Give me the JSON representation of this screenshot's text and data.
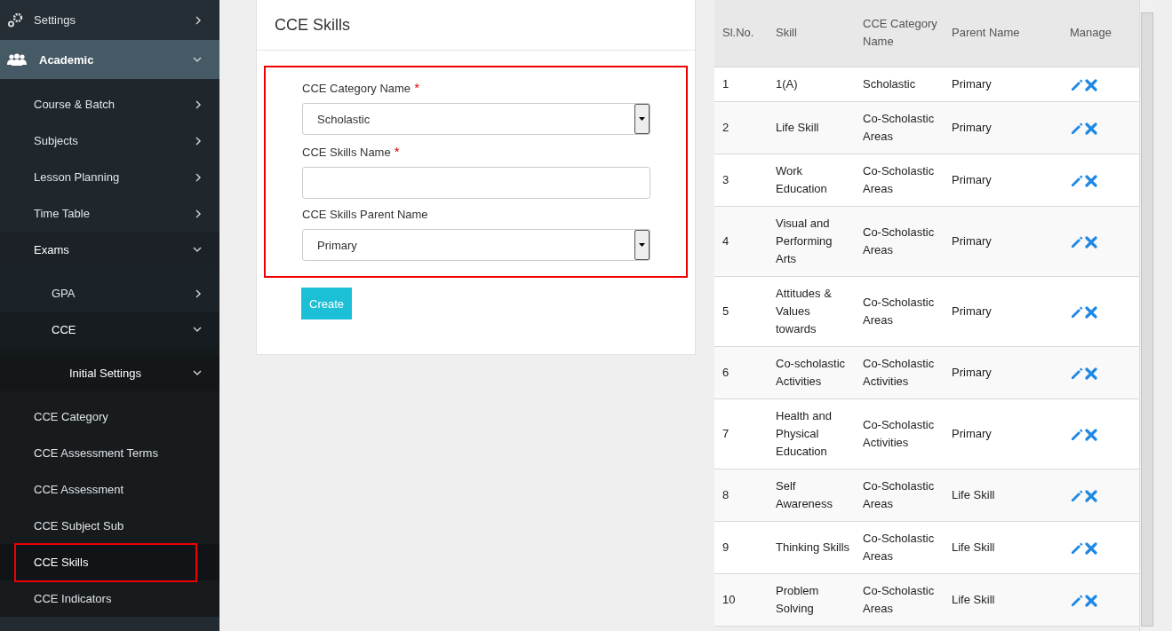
{
  "sidebar": {
    "items": [
      {
        "label": "Settings",
        "expanded": false
      },
      {
        "label": "Academic",
        "expanded": true,
        "children": [
          {
            "label": "Course & Batch",
            "expanded": false
          },
          {
            "label": "Subjects",
            "expanded": false
          },
          {
            "label": "Lesson Planning",
            "expanded": false
          },
          {
            "label": "Time Table",
            "expanded": false
          },
          {
            "label": "Exams",
            "expanded": true,
            "children": [
              {
                "label": "GPA",
                "expanded": false
              },
              {
                "label": "CCE",
                "expanded": true,
                "children": [
                  {
                    "label": "Initial Settings",
                    "expanded": true,
                    "children": [
                      {
                        "label": "CCE Category",
                        "selected": false,
                        "highlighted": false
                      },
                      {
                        "label": "CCE Assessment Terms",
                        "selected": false,
                        "highlighted": false
                      },
                      {
                        "label": "CCE Assessment",
                        "selected": false,
                        "highlighted": false
                      },
                      {
                        "label": "CCE Subject Sub",
                        "selected": false,
                        "highlighted": false
                      },
                      {
                        "label": "CCE Skills",
                        "selected": true,
                        "highlighted": true
                      },
                      {
                        "label": "CCE Indicators",
                        "selected": false,
                        "highlighted": false
                      }
                    ]
                  }
                ]
              }
            ]
          }
        ]
      }
    ]
  },
  "form": {
    "title": "CCE Skills",
    "highlighted": true,
    "fields": [
      {
        "kind": "select",
        "label": "CCE Category Name",
        "required": true,
        "value": "Scholastic"
      },
      {
        "kind": "text",
        "label": "CCE Skills Name",
        "required": true
      },
      {
        "kind": "select",
        "label": "CCE Skills Parent Name",
        "required": false,
        "value": "Primary"
      }
    ],
    "required_mark": "*",
    "submit": "Create"
  },
  "table": {
    "columns": [
      "Sl.No.",
      "Skill",
      "CCE Category Name",
      "Parent Name",
      "Manage"
    ],
    "rows": [
      [
        "1",
        "1(A)",
        "Scholastic",
        "Primary"
      ],
      [
        "2",
        "Life Skill",
        "Co-Scholastic Areas",
        "Primary"
      ],
      [
        "3",
        "Work Education",
        "Co-Scholastic Areas",
        "Primary"
      ],
      [
        "4",
        "Visual and Performing Arts",
        "Co-Scholastic Areas",
        "Primary"
      ],
      [
        "5",
        "Attitudes & Values towards",
        "Co-Scholastic Areas",
        "Primary"
      ],
      [
        "6",
        "Co-scholastic Activities",
        "Co-Scholastic Activities",
        "Primary"
      ],
      [
        "7",
        "Health and Physical Education",
        "Co-Scholastic Activities",
        "Primary"
      ],
      [
        "8",
        "Self Awareness",
        "Co-Scholastic Areas",
        "Life Skill"
      ],
      [
        "9",
        "Thinking Skills",
        "Co-Scholastic Areas",
        "Life Skill"
      ],
      [
        "10",
        "Problem Solving",
        "Co-Scholastic Areas",
        "Life Skill"
      ]
    ]
  }
}
